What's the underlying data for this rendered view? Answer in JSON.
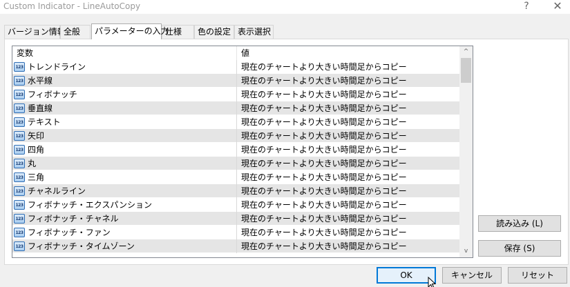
{
  "window": {
    "title": "Custom Indicator - LineAutoCopy",
    "help_glyph": "?",
    "close_glyph": "✕"
  },
  "tabs": [
    {
      "label": "バージョン情報"
    },
    {
      "label": "全般"
    },
    {
      "label": "パラメーターの入力"
    },
    {
      "label": "仕様"
    },
    {
      "label": "色の設定"
    },
    {
      "label": "表示選択"
    }
  ],
  "table": {
    "headers": {
      "variable": "変数",
      "value": "値"
    },
    "icon_text": "123",
    "rows": [
      {
        "name": "トレンドライン",
        "value": "現在のチャートより大きい時間足からコピー"
      },
      {
        "name": "水平線",
        "value": "現在のチャートより大きい時間足からコピー"
      },
      {
        "name": "フィボナッチ",
        "value": "現在のチャートより大きい時間足からコピー"
      },
      {
        "name": "垂直線",
        "value": "現在のチャートより大きい時間足からコピー"
      },
      {
        "name": "テキスト",
        "value": "現在のチャートより大きい時間足からコピー"
      },
      {
        "name": "矢印",
        "value": "現在のチャートより大きい時間足からコピー"
      },
      {
        "name": "四角",
        "value": "現在のチャートより大きい時間足からコピー"
      },
      {
        "name": "丸",
        "value": "現在のチャートより大きい時間足からコピー"
      },
      {
        "name": "三角",
        "value": "現在のチャートより大きい時間足からコピー"
      },
      {
        "name": "チャネルライン",
        "value": "現在のチャートより大きい時間足からコピー"
      },
      {
        "name": "フィボナッチ・エクスパンション",
        "value": "現在のチャートより大きい時間足からコピー"
      },
      {
        "name": "フィボナッチ・チャネル",
        "value": "現在のチャートより大きい時間足からコピー"
      },
      {
        "name": "フィボナッチ・ファン",
        "value": "現在のチャートより大きい時間足からコピー"
      },
      {
        "name": "フィボナッチ・タイムゾーン",
        "value": "現在のチャートより大きい時間足からコピー"
      }
    ]
  },
  "buttons": {
    "load": "読み込み (L)",
    "save": "保存 (S)",
    "ok": "OK",
    "cancel": "キャンセル",
    "reset": "リセット"
  },
  "scrollbar": {
    "up_glyph": "^",
    "down_glyph": "v"
  }
}
